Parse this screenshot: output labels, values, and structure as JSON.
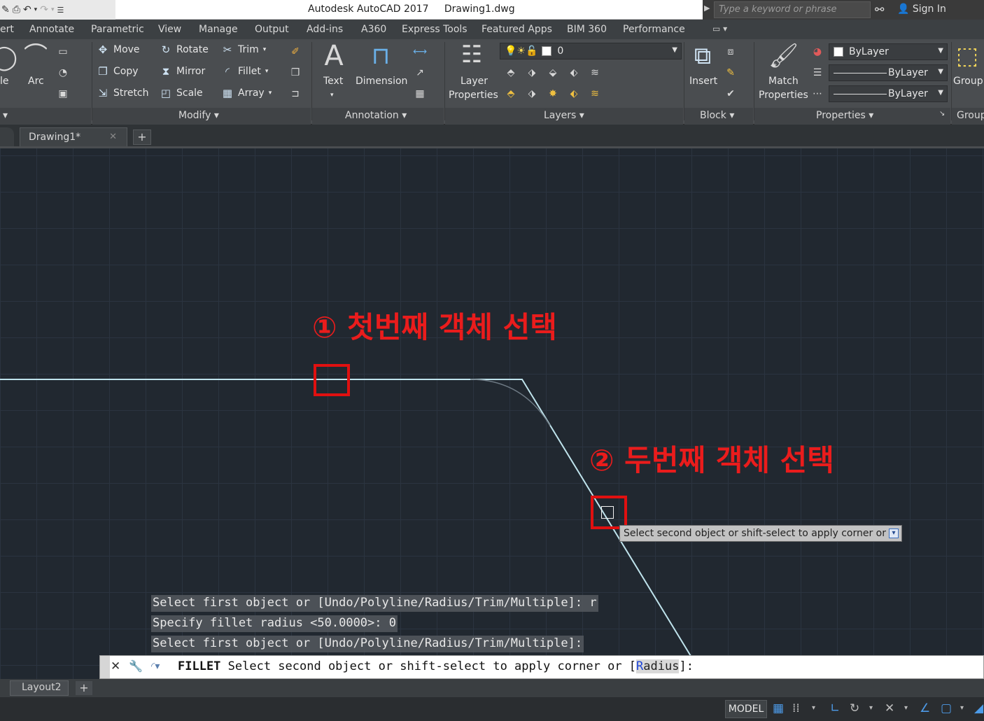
{
  "titlebar": {
    "title": "Autodesk AutoCAD 2017",
    "document": "Drawing1.dwg",
    "search_placeholder": "Type a keyword or phrase",
    "signin_label": "Sign In"
  },
  "ribbon_tabs": [
    "ert",
    "Annotate",
    "Parametric",
    "View",
    "Manage",
    "Output",
    "Add-ins",
    "A360",
    "Express Tools",
    "Featured Apps",
    "BIM 360",
    "Performance"
  ],
  "draw_panel": {
    "partial_label": "le",
    "arc_label": "Arc"
  },
  "modify_panel": {
    "title": "Modify",
    "move": "Move",
    "copy": "Copy",
    "stretch": "Stretch",
    "rotate": "Rotate",
    "mirror": "Mirror",
    "scale": "Scale",
    "trim": "Trim",
    "fillet": "Fillet",
    "array": "Array"
  },
  "annotation_panel": {
    "title": "Annotation",
    "text": "Text",
    "dimension": "Dimension"
  },
  "layers_panel": {
    "title": "Layers",
    "layer_properties_1": "Layer",
    "layer_properties_2": "Properties",
    "current_layer": "0"
  },
  "block_panel": {
    "title": "Block",
    "insert": "Insert"
  },
  "properties_panel": {
    "title": "Properties",
    "match_1": "Match",
    "match_2": "Properties",
    "color": "ByLayer",
    "linetype": "ByLayer",
    "lineweight": "ByLayer"
  },
  "groups_panel": {
    "group": "Group",
    "title": "Group"
  },
  "file_tab": {
    "name": "Drawing1*"
  },
  "annotations": {
    "step1": "① 첫번째 객체 선택",
    "step2": "② 두번째 객체 선택"
  },
  "tooltip": {
    "text": "Select second object or shift-select to apply corner or"
  },
  "history": [
    "Select first object or [Undo/Polyline/Radius/Trim/Multiple]: r",
    "Specify fillet radius <50.0000>: 0",
    "Select first object or [Undo/Polyline/Radius/Trim/Multiple]:"
  ],
  "command": {
    "name": "FILLET",
    "prompt": " Select second object or shift-select to apply corner or [",
    "option_hotkey": "R",
    "option_rest": "adius",
    "suffix": "]:"
  },
  "layout_tab": "Layout2",
  "status": {
    "model": "MODEL"
  },
  "colors": {
    "annotation_red": "#ea1c1c",
    "polyline": "#bfe3ec",
    "canvas_bg": "#212830"
  }
}
